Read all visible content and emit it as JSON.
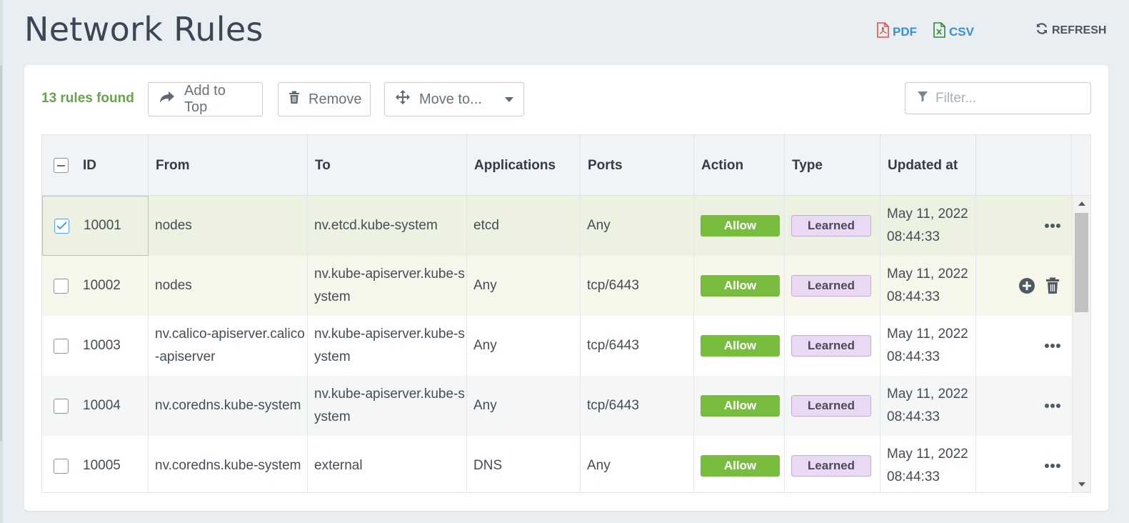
{
  "page": {
    "title": "Network Rules",
    "export_pdf": "PDF",
    "export_csv": "CSV",
    "refresh": "REFRESH"
  },
  "toolbar": {
    "count": "13 rules found",
    "add_to_top": "Add to Top",
    "remove": "Remove",
    "move_to": "Move to...",
    "filter_placeholder": "Filter..."
  },
  "columns": {
    "id": "ID",
    "from": "From",
    "to": "To",
    "applications": "Applications",
    "ports": "Ports",
    "action": "Action",
    "type": "Type",
    "updated": "Updated at"
  },
  "rows": [
    {
      "id": "10001",
      "from": "nodes",
      "to": "nv.etcd.kube-system",
      "applications": "etcd",
      "ports": "Any",
      "action": "Allow",
      "type": "Learned",
      "updated": "May 11, 2022 08:44:33",
      "checked": true,
      "row_actions": "more"
    },
    {
      "id": "10002",
      "from": "nodes",
      "to": "nv.kube-apiserver.kube-system",
      "applications": "Any",
      "ports": "tcp/6443",
      "action": "Allow",
      "type": "Learned",
      "updated": "May 11, 2022 08:44:33",
      "checked": false,
      "row_actions": "add-delete"
    },
    {
      "id": "10003",
      "from": "nv.calico-apiserver.calico-apiserver",
      "to": "nv.kube-apiserver.kube-system",
      "applications": "Any",
      "ports": "tcp/6443",
      "action": "Allow",
      "type": "Learned",
      "updated": "May 11, 2022 08:44:33",
      "checked": false,
      "row_actions": "more"
    },
    {
      "id": "10004",
      "from": "nv.coredns.kube-system",
      "to": "nv.kube-apiserver.kube-system",
      "applications": "Any",
      "ports": "tcp/6443",
      "action": "Allow",
      "type": "Learned",
      "updated": "May 11, 2022 08:44:33",
      "checked": false,
      "row_actions": "more"
    },
    {
      "id": "10005",
      "from": "nv.coredns.kube-system",
      "to": "external",
      "applications": "DNS",
      "ports": "Any",
      "action": "Allow",
      "type": "Learned",
      "updated": "May 11, 2022 08:44:33",
      "checked": false,
      "row_actions": "more"
    }
  ],
  "colors": {
    "count_green": "#67a44b",
    "allow_green": "#78bd3e",
    "learned_bg": "#e9d9f3",
    "link_blue": "#3a8fd6",
    "selected_row": "#edf1e2",
    "hover_row": "#f6f7ea"
  },
  "icons": {
    "pdf": "pdf-file-icon",
    "csv": "excel-file-icon",
    "refresh": "refresh-icon",
    "add_to_top": "share-arrow-icon",
    "remove": "trash-icon",
    "move": "move-arrows-icon",
    "filter": "funnel-icon"
  }
}
